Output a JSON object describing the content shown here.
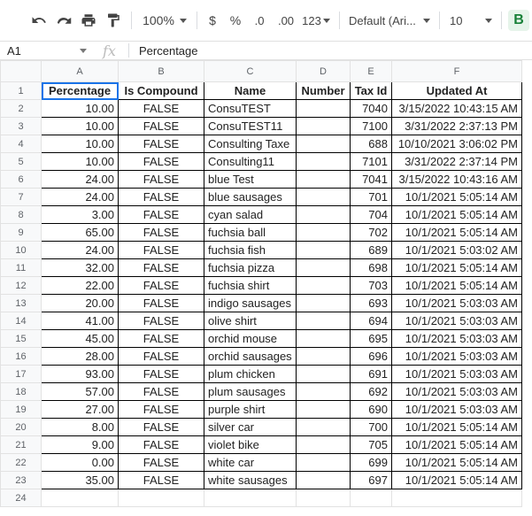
{
  "toolbar": {
    "zoom": "100%",
    "currency": "$",
    "percent": "%",
    "dec_decrease": ".0",
    "dec_increase": ".00",
    "more_formats": "123",
    "font": "Default (Ari...",
    "font_size": "10",
    "bold": "B"
  },
  "formula_bar": {
    "cell_ref": "A1",
    "fx": "fx",
    "value": "Percentage"
  },
  "columns": [
    "A",
    "B",
    "C",
    "D",
    "E",
    "F"
  ],
  "header": [
    "Percentage",
    "Is Compound",
    "Name",
    "Number",
    "Tax Id",
    "Updated At"
  ],
  "rows": [
    [
      "10.00",
      "FALSE",
      "ConsuTEST",
      "",
      "7040",
      "3/15/2022 10:43:15 AM"
    ],
    [
      "10.00",
      "FALSE",
      "ConsuTEST11",
      "",
      "7100",
      "3/31/2022 2:37:13 PM"
    ],
    [
      "10.00",
      "FALSE",
      "Consulting Taxe",
      "",
      "688",
      "10/10/2021 3:06:02 PM"
    ],
    [
      "10.00",
      "FALSE",
      "Consulting11",
      "",
      "7101",
      "3/31/2022 2:37:14 PM"
    ],
    [
      "24.00",
      "FALSE",
      "blue Test",
      "",
      "7041",
      "3/15/2022 10:43:16 AM"
    ],
    [
      "24.00",
      "FALSE",
      "blue sausages",
      "",
      "701",
      "10/1/2021 5:05:14 AM"
    ],
    [
      "3.00",
      "FALSE",
      "cyan salad",
      "",
      "704",
      "10/1/2021 5:05:14 AM"
    ],
    [
      "65.00",
      "FALSE",
      "fuchsia ball",
      "",
      "702",
      "10/1/2021 5:05:14 AM"
    ],
    [
      "24.00",
      "FALSE",
      "fuchsia fish",
      "",
      "689",
      "10/1/2021 5:03:02 AM"
    ],
    [
      "32.00",
      "FALSE",
      "fuchsia pizza",
      "",
      "698",
      "10/1/2021 5:05:14 AM"
    ],
    [
      "22.00",
      "FALSE",
      "fuchsia shirt",
      "",
      "703",
      "10/1/2021 5:05:14 AM"
    ],
    [
      "20.00",
      "FALSE",
      "indigo sausages",
      "",
      "693",
      "10/1/2021 5:03:03 AM"
    ],
    [
      "41.00",
      "FALSE",
      "olive shirt",
      "",
      "694",
      "10/1/2021 5:03:03 AM"
    ],
    [
      "45.00",
      "FALSE",
      "orchid mouse",
      "",
      "695",
      "10/1/2021 5:03:03 AM"
    ],
    [
      "28.00",
      "FALSE",
      "orchid sausages",
      "",
      "696",
      "10/1/2021 5:03:03 AM"
    ],
    [
      "93.00",
      "FALSE",
      "plum chicken",
      "",
      "691",
      "10/1/2021 5:03:03 AM"
    ],
    [
      "57.00",
      "FALSE",
      "plum sausages",
      "",
      "692",
      "10/1/2021 5:03:03 AM"
    ],
    [
      "27.00",
      "FALSE",
      "purple shirt",
      "",
      "690",
      "10/1/2021 5:03:03 AM"
    ],
    [
      "8.00",
      "FALSE",
      "silver car",
      "",
      "700",
      "10/1/2021 5:05:14 AM"
    ],
    [
      "9.00",
      "FALSE",
      "violet bike",
      "",
      "705",
      "10/1/2021 5:05:14 AM"
    ],
    [
      "0.00",
      "FALSE",
      "white car",
      "",
      "699",
      "10/1/2021 5:05:14 AM"
    ],
    [
      "35.00",
      "FALSE",
      "white sausages",
      "",
      "697",
      "10/1/2021 5:05:14 AM"
    ]
  ],
  "row_numbers": [
    "1",
    "2",
    "3",
    "4",
    "5",
    "6",
    "7",
    "8",
    "9",
    "10",
    "11",
    "12",
    "13",
    "14",
    "15",
    "16",
    "17",
    "18",
    "19",
    "20",
    "21",
    "22",
    "23",
    "24"
  ]
}
